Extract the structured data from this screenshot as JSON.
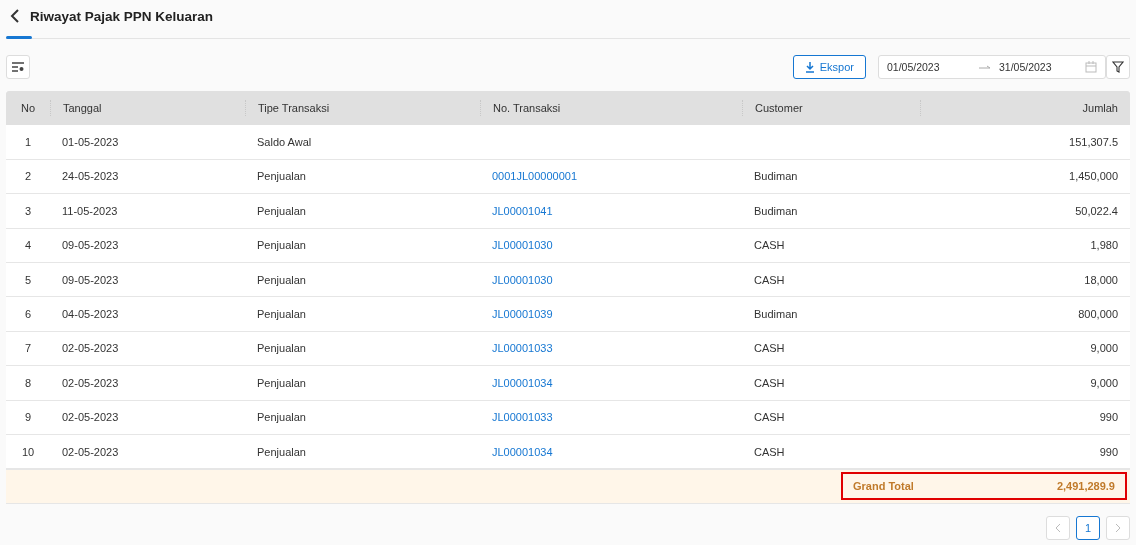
{
  "page": {
    "title": "Riwayat Pajak PPN Keluaran"
  },
  "toolbar": {
    "export_button": "Ekspor",
    "date_from": "01/05/2023",
    "date_to": "31/05/2023"
  },
  "table": {
    "columns": [
      "No",
      "Tanggal",
      "Tipe Transaksi",
      "No. Transaksi",
      "Customer",
      "Jumlah"
    ],
    "rows": [
      {
        "no": "1",
        "date": "01-05-2023",
        "type": "Saldo Awal",
        "transaction": "",
        "customer": "",
        "amount": "151,307.5"
      },
      {
        "no": "2",
        "date": "24-05-2023",
        "type": "Penjualan",
        "transaction": "0001JL00000001",
        "customer": "Budiman",
        "amount": "1,450,000"
      },
      {
        "no": "3",
        "date": "11-05-2023",
        "type": "Penjualan",
        "transaction": "JL00001041",
        "customer": "Budiman",
        "amount": "50,022.4"
      },
      {
        "no": "4",
        "date": "09-05-2023",
        "type": "Penjualan",
        "transaction": "JL00001030",
        "customer": "CASH",
        "amount": "1,980"
      },
      {
        "no": "5",
        "date": "09-05-2023",
        "type": "Penjualan",
        "transaction": "JL00001030",
        "customer": "CASH",
        "amount": "18,000"
      },
      {
        "no": "6",
        "date": "04-05-2023",
        "type": "Penjualan",
        "transaction": "JL00001039",
        "customer": "Budiman",
        "amount": "800,000"
      },
      {
        "no": "7",
        "date": "02-05-2023",
        "type": "Penjualan",
        "transaction": "JL00001033",
        "customer": "CASH",
        "amount": "9,000"
      },
      {
        "no": "8",
        "date": "02-05-2023",
        "type": "Penjualan",
        "transaction": "JL00001034",
        "customer": "CASH",
        "amount": "9,000"
      },
      {
        "no": "9",
        "date": "02-05-2023",
        "type": "Penjualan",
        "transaction": "JL00001033",
        "customer": "CASH",
        "amount": "990"
      },
      {
        "no": "10",
        "date": "02-05-2023",
        "type": "Penjualan",
        "transaction": "JL00001034",
        "customer": "CASH",
        "amount": "990"
      }
    ],
    "grand_total": {
      "label": "Grand Total",
      "value": "2,491,289.9",
      "highlighted": true
    }
  },
  "pagination": {
    "pages": [
      {
        "label": "1",
        "selected": true
      }
    ]
  }
}
